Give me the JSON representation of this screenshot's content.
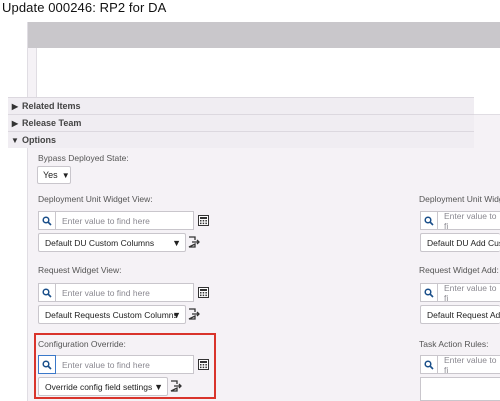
{
  "page": {
    "title": "Update  000246: RP2 for DA"
  },
  "sections": {
    "related_items": "Related Items",
    "release_team": "Release Team",
    "options": "Options"
  },
  "bypass": {
    "label": "Bypass Deployed State:",
    "value": "Yes"
  },
  "du_widget_view": {
    "label": "Deployment Unit Widget View:",
    "placeholder": "Enter value to find here",
    "selected": "Default DU Custom Columns"
  },
  "du_widget_add": {
    "label": "Deployment Unit Widge",
    "placeholder": "Enter value to fi",
    "selected": "Default DU Add Cus"
  },
  "request_widget_view": {
    "label": "Request Widget View:",
    "placeholder": "Enter value to find here",
    "selected": "Default Requests Custom Columns"
  },
  "request_widget_add": {
    "label": "Request Widget Add:",
    "placeholder": "Enter value to fi",
    "selected": "Default Request Ad"
  },
  "config_override": {
    "label": "Configuration Override:",
    "placeholder": "Enter value to find here",
    "selected": "Override config field settings"
  },
  "task_action_rules": {
    "label": "Task Action Rules:",
    "placeholder": "Enter value to fi"
  },
  "colors": {
    "highlight": "#d9342b",
    "panel_bg": "#f5f2f6",
    "header_bar": "#c9c7cb",
    "search_icon": "#1a4f8a"
  }
}
